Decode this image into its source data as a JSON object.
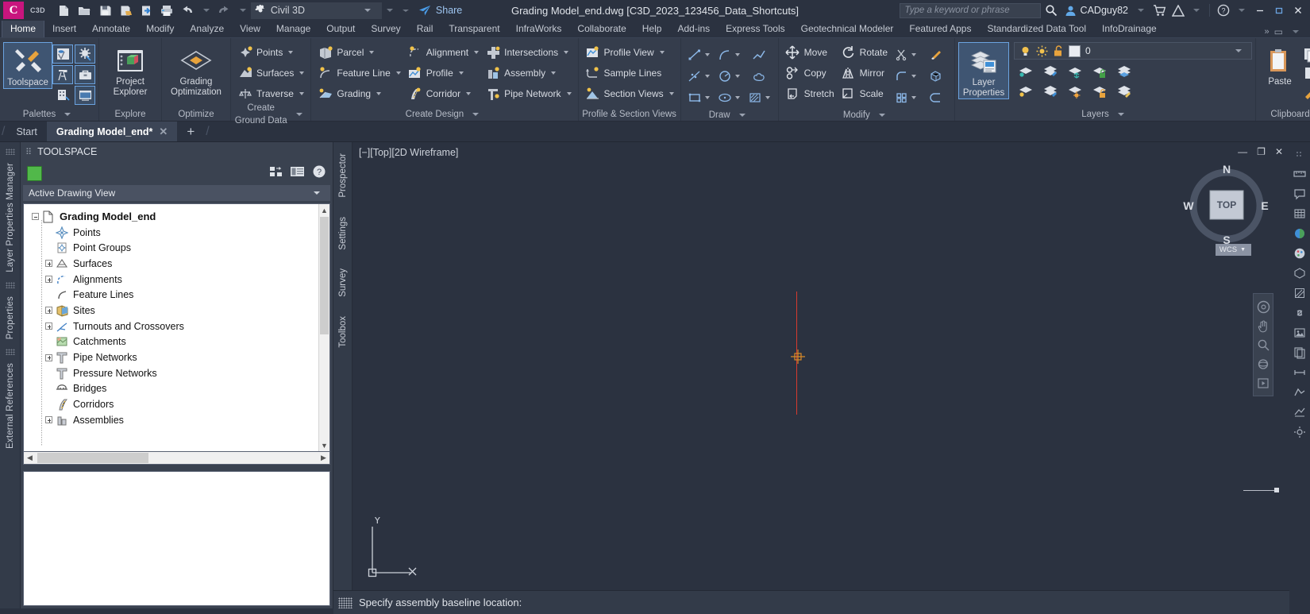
{
  "titlebar": {
    "logo": "C",
    "product_badge": "C3D",
    "quick_access": [
      {
        "name": "new-icon",
        "label": "New"
      },
      {
        "name": "open-icon",
        "label": "Open"
      },
      {
        "name": "save-icon",
        "label": "Save"
      },
      {
        "name": "saveas-icon",
        "label": "Save As"
      },
      {
        "name": "export-icon",
        "label": "Export"
      },
      {
        "name": "plot-icon",
        "label": "Plot"
      },
      {
        "name": "undo-icon",
        "label": "Undo"
      },
      {
        "name": "redo-icon",
        "label": "Redo"
      }
    ],
    "workspace": "Civil 3D",
    "share_label": "Share",
    "document_title": "Grading Model_end.dwg [C3D_2023_123456_Data_Shortcuts]",
    "search_placeholder": "Type a keyword or phrase",
    "user_name": "CADguy82",
    "window_buttons": [
      "minimize",
      "restore",
      "close"
    ]
  },
  "ribbon_tabs": [
    {
      "label": "Home",
      "active": true
    },
    {
      "label": "Insert",
      "active": false
    },
    {
      "label": "Annotate",
      "active": false
    },
    {
      "label": "Modify",
      "active": false
    },
    {
      "label": "Analyze",
      "active": false
    },
    {
      "label": "View",
      "active": false
    },
    {
      "label": "Manage",
      "active": false
    },
    {
      "label": "Output",
      "active": false
    },
    {
      "label": "Survey",
      "active": false
    },
    {
      "label": "Rail",
      "active": false
    },
    {
      "label": "Transparent",
      "active": false
    },
    {
      "label": "InfraWorks",
      "active": false
    },
    {
      "label": "Collaborate",
      "active": false
    },
    {
      "label": "Help",
      "active": false
    },
    {
      "label": "Add-ins",
      "active": false
    },
    {
      "label": "Express Tools",
      "active": false
    },
    {
      "label": "Geotechnical Modeler",
      "active": false
    },
    {
      "label": "Featured Apps",
      "active": false
    },
    {
      "label": "Standardized Data Tool",
      "active": false
    },
    {
      "label": "InfoDrainage",
      "active": false
    }
  ],
  "ribbon": {
    "palettes": {
      "title": "Palettes",
      "toolspace_label": "Toolspace",
      "small_buttons": [
        {
          "name": "prospector-palette-icon"
        },
        {
          "name": "settings-palette-icon"
        },
        {
          "name": "survey-palette-icon"
        },
        {
          "name": "toolbox-palette-icon"
        },
        {
          "name": "inquiry-palette-icon"
        },
        {
          "name": "panorama-palette-icon"
        }
      ]
    },
    "explore": {
      "title": "Explore",
      "button": "Project Explorer"
    },
    "optimize": {
      "title": "Optimize",
      "button": "Grading Optimization"
    },
    "create_ground_data": {
      "title": "Create Ground Data",
      "items": [
        {
          "label": "Points",
          "icon": "points-icon"
        },
        {
          "label": "Surfaces",
          "icon": "surfaces-icon"
        },
        {
          "label": "Traverse",
          "icon": "traverse-icon"
        }
      ]
    },
    "create_design": {
      "title": "Create Design",
      "col1": [
        {
          "label": "Parcel",
          "icon": "parcel-icon"
        },
        {
          "label": "Feature Line",
          "icon": "feature-line-icon"
        },
        {
          "label": "Grading",
          "icon": "grading-icon"
        }
      ],
      "col2": [
        {
          "label": "Alignment",
          "icon": "alignment-icon"
        },
        {
          "label": "Profile",
          "icon": "profile-icon"
        },
        {
          "label": "Corridor",
          "icon": "corridor-icon"
        }
      ],
      "col3": [
        {
          "label": "Intersections",
          "icon": "intersections-icon"
        },
        {
          "label": "Assembly",
          "icon": "assembly-icon"
        },
        {
          "label": "Pipe Network",
          "icon": "pipe-network-icon"
        }
      ]
    },
    "profile_section_views": {
      "title": "Profile & Section Views",
      "items": [
        {
          "label": "Profile View",
          "icon": "profile-view-icon"
        },
        {
          "label": "Sample Lines",
          "icon": "sample-lines-icon"
        },
        {
          "label": "Section Views",
          "icon": "section-views-icon"
        }
      ]
    },
    "draw": {
      "title": "Draw",
      "items": [
        {
          "name": "line-icon"
        },
        {
          "name": "arc-icon"
        },
        {
          "name": "polyline-icon"
        },
        {
          "name": "spline-icon"
        },
        {
          "name": "circle-icon"
        },
        {
          "name": "revcloud-icon"
        },
        {
          "name": "rectangle-icon"
        },
        {
          "name": "ellipse-icon"
        },
        {
          "name": "hatch-icon"
        }
      ]
    },
    "modify": {
      "title": "Modify",
      "items": [
        {
          "label": "Move",
          "icon": "move-icon"
        },
        {
          "label": "Rotate",
          "icon": "rotate-icon"
        },
        {
          "label": "Copy",
          "icon": "copy-icon"
        },
        {
          "label": "Mirror",
          "icon": "mirror-icon"
        },
        {
          "label": "Stretch",
          "icon": "stretch-icon"
        },
        {
          "label": "Scale",
          "icon": "scale-icon"
        }
      ],
      "extra": [
        {
          "name": "trim-icon"
        },
        {
          "name": "erase-icon"
        },
        {
          "name": "fillet-icon"
        },
        {
          "name": "extrude-icon"
        },
        {
          "name": "array-icon"
        },
        {
          "name": "offset-icon"
        }
      ]
    },
    "layers": {
      "title": "Layers",
      "layer_properties_label": "Layer Properties",
      "current_layer": "0",
      "layer_state_icons": [
        "bulb-on-icon",
        "sun-icon",
        "unlock-icon"
      ],
      "tool_icons": [
        "layer-isolate-icon",
        "layer-edit-icon",
        "layer-freeze-icon",
        "layer-lock-icon",
        "layer-merge-icon",
        "layer-off-icon",
        "layer-make-current-icon",
        "layer-thaw-icon",
        "layer-unlock-icon",
        "layer-match-icon"
      ]
    },
    "clipboard": {
      "title": "Clipboard",
      "paste_label": "Paste"
    }
  },
  "doc_tabs": [
    {
      "label": "Start",
      "active": false,
      "closable": false
    },
    {
      "label": "Grading Model_end*",
      "active": true,
      "closable": true
    }
  ],
  "left_rail": [
    "Layer Properties Manager",
    "Properties",
    "External References"
  ],
  "toolspace": {
    "title": "TOOLSPACE",
    "view_selector": "Active Drawing View",
    "header_icons": [
      "data-shortcuts-icon",
      "panorama-icon",
      "help-icon"
    ],
    "tree": [
      {
        "label": "Grading Model_end",
        "level": 0,
        "expander": "minus",
        "icon": "drawing-icon",
        "bold": true
      },
      {
        "label": "Points",
        "level": 1,
        "expander": "none",
        "icon": "points-node-icon"
      },
      {
        "label": "Point Groups",
        "level": 1,
        "expander": "none",
        "icon": "point-groups-node-icon"
      },
      {
        "label": "Surfaces",
        "level": 1,
        "expander": "plus",
        "icon": "surfaces-node-icon"
      },
      {
        "label": "Alignments",
        "level": 1,
        "expander": "plus",
        "icon": "alignments-node-icon"
      },
      {
        "label": "Feature Lines",
        "level": 1,
        "expander": "none",
        "icon": "feature-lines-node-icon"
      },
      {
        "label": "Sites",
        "level": 1,
        "expander": "plus",
        "icon": "sites-node-icon"
      },
      {
        "label": "Turnouts and Crossovers",
        "level": 1,
        "expander": "plus",
        "icon": "turnouts-node-icon"
      },
      {
        "label": "Catchments",
        "level": 1,
        "expander": "none",
        "icon": "catchments-node-icon"
      },
      {
        "label": "Pipe Networks",
        "level": 1,
        "expander": "plus",
        "icon": "pipe-networks-node-icon"
      },
      {
        "label": "Pressure Networks",
        "level": 1,
        "expander": "none",
        "icon": "pressure-networks-node-icon"
      },
      {
        "label": "Bridges",
        "level": 1,
        "expander": "none",
        "icon": "bridges-node-icon"
      },
      {
        "label": "Corridors",
        "level": 1,
        "expander": "none",
        "icon": "corridors-node-icon"
      },
      {
        "label": "Assemblies",
        "level": 1,
        "expander": "plus",
        "icon": "assemblies-node-icon"
      }
    ],
    "vertical_tabs": [
      "Prospector",
      "Settings",
      "Survey",
      "Toolbox"
    ]
  },
  "viewport": {
    "label": "[−][Top][2D Wireframe]",
    "viewcube": {
      "top": "TOP",
      "north": "N",
      "south": "S",
      "east": "E",
      "west": "W"
    },
    "wcs_label": "WCS",
    "ucs": {
      "y_label": "Y",
      "x_label": "X"
    }
  },
  "command_line": {
    "prompt": "Specify assembly baseline location:"
  },
  "colors": {
    "window_bg": "#2b3240",
    "ribbon_bg": "#353d4c",
    "panel_bg": "#3a4250",
    "accent_blue": "#6ba3e0",
    "link_blue": "#9ec5f0",
    "brand_magenta": "#c8157e",
    "crosshair_red": "#d63a2f",
    "tree_bg": "#ffffff"
  }
}
